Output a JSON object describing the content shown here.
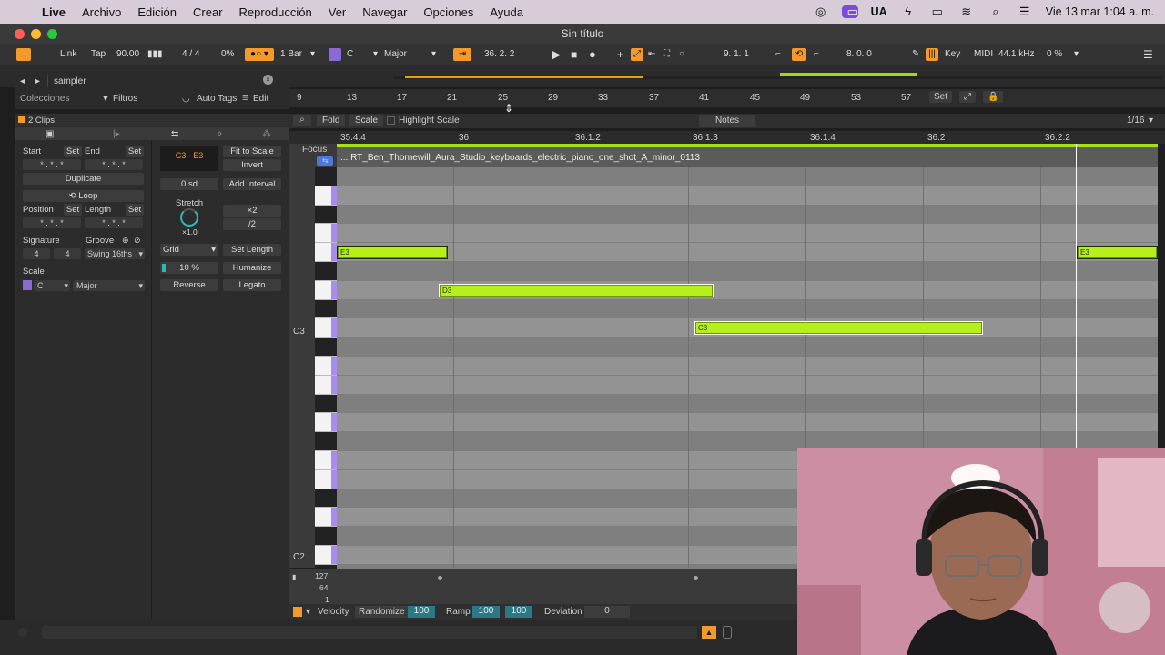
{
  "menubar": {
    "app": "Live",
    "items": [
      "Archivo",
      "Edición",
      "Crear",
      "Reproducción",
      "Ver",
      "Navegar",
      "Opciones",
      "Ayuda"
    ],
    "input_lang": "UA",
    "clock": "Vie 13 mar  1:04 a. m."
  },
  "window": {
    "title": "Sin título"
  },
  "transport": {
    "link": "Link",
    "tap": "Tap",
    "tempo": "90.00",
    "signature": "4 / 4",
    "cpu_percent": "0%",
    "quantize": "1 Bar",
    "scale_root": "C",
    "scale_mode": "Major",
    "position": "36.  2.  2",
    "loop_start": "9.  1.  1",
    "loop_length": "8.  0.  0",
    "key": "Key",
    "midi": "MIDI",
    "sample_rate": "44.1 kHz",
    "cpu_load": "0 %"
  },
  "browser": {
    "search_value": "sampler",
    "collections": "Colecciones",
    "filters": "Filtros",
    "auto_tags": "Auto Tags",
    "edit": "Edit"
  },
  "ruler": {
    "marks": [
      "9",
      "13",
      "17",
      "21",
      "25",
      "29",
      "33",
      "37",
      "41",
      "45",
      "49",
      "53",
      "57"
    ],
    "set": "Set"
  },
  "clip_panel": {
    "header": "2 Clips",
    "start": "Start",
    "end": "End",
    "set": "Set",
    "duplicate": "Duplicate",
    "loop": "Loop",
    "position": "Position",
    "length": "Length",
    "signature": "Signature",
    "sig_num": "4",
    "sig_den": "4",
    "groove": "Groove",
    "groove_value": "Swing 16ths",
    "scale": "Scale",
    "scale_root": "C",
    "scale_mode": "Major",
    "range": "C3 - E3",
    "fit_to_scale": "Fit to Scale",
    "invert": "Invert",
    "sd": "0 sd",
    "add_interval": "Add Interval",
    "stretch": "Stretch",
    "x2": "×2",
    "half": "/2",
    "stretch_value": "×1.0",
    "grid": "Grid",
    "set_length": "Set Length",
    "humanize_amount": "10 %",
    "humanize": "Humanize",
    "reverse": "Reverse",
    "legato": "Legato"
  },
  "editor": {
    "fold": "Fold",
    "scale": "Scale",
    "highlight_scale": "Highlight Scale",
    "notes": "Notes",
    "grid_res": "1/16",
    "focus": "Focus",
    "clip_name": "... RT_Ben_Thornewill_Aura_Studio_keyboards_electric_piano_one_shot_A_minor_0113",
    "time_labels": [
      "35.4.4",
      "36",
      "36.1.2",
      "36.1.3",
      "36.1.4",
      "36.2",
      "36.2.2"
    ],
    "pitch_labels": [
      "C3",
      "C2"
    ],
    "notes_list": [
      {
        "name": "E3"
      },
      {
        "name": "D3"
      },
      {
        "name": "C3"
      },
      {
        "name": "E3"
      }
    ]
  },
  "velocity_lane": {
    "ticks": [
      "127",
      "64",
      "1"
    ],
    "label": "Velocity",
    "randomize": "Randomize",
    "randomize_value": "100",
    "ramp": "Ramp",
    "ramp_a": "100",
    "ramp_b": "100",
    "deviation": "Deviation",
    "deviation_value": "0"
  },
  "colors": {
    "note": "#b6f01c",
    "accent_orange": "#f39a2a",
    "accent_purple": "#8a6bd6"
  }
}
